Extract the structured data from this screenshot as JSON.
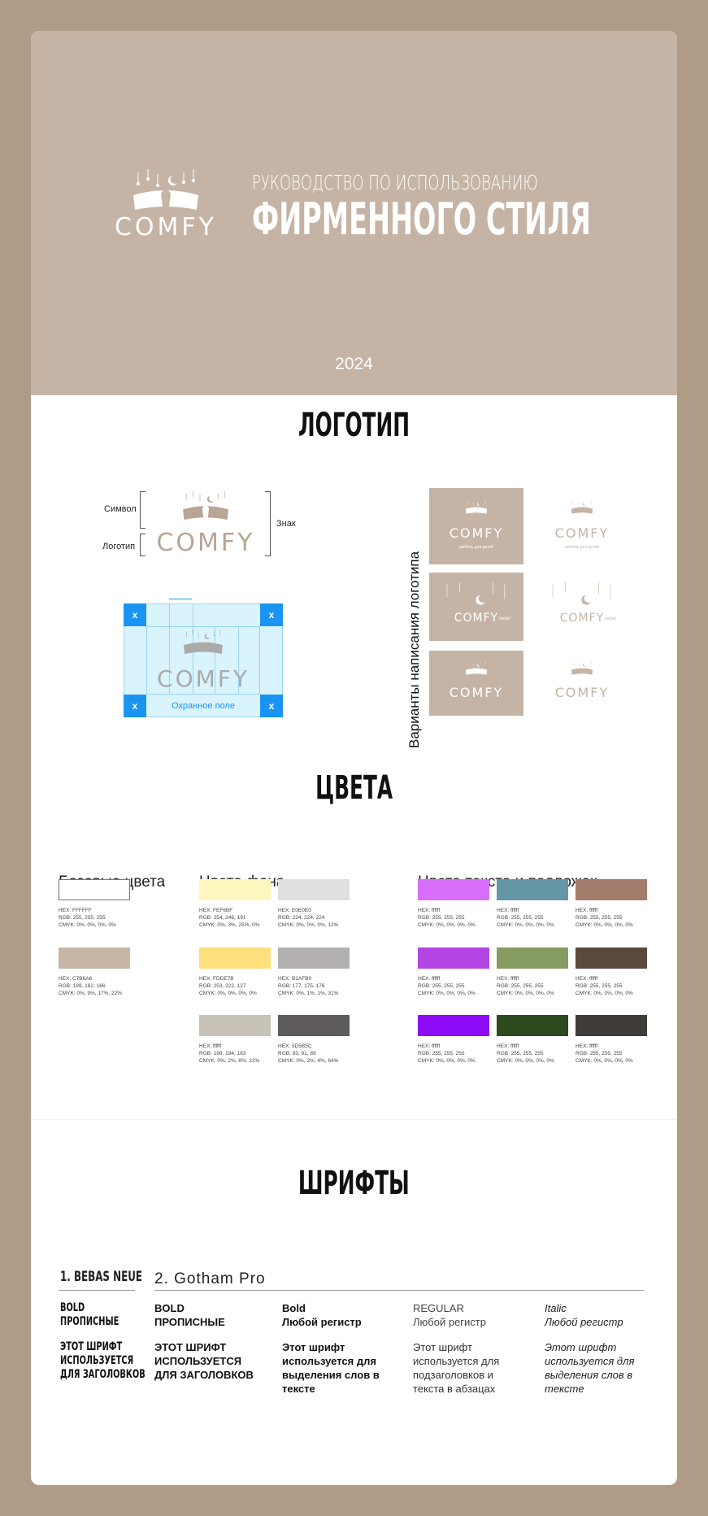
{
  "hero": {
    "brand": "COMFY",
    "subtitle": "РУКОВОДСТВО ПО ИСПОЛЬЗОВАНИЮ",
    "title": "ФИРМЕННОГО СТИЛЯ",
    "year": "2024"
  },
  "logo_section": {
    "title": "ЛОГОТИП",
    "label_symbol": "Символ",
    "label_logotype": "Логотип",
    "label_sign": "Знак",
    "protect_label": "Охранное поле",
    "x_marker": "x",
    "variants_label": "Варианты написания логотипа",
    "variants": [
      {
        "word": "COMFY",
        "tagline": "мебель для детей"
      },
      {
        "word": "COMFY",
        "tagline": "мебель для детей"
      },
      {
        "word": "COMFY",
        "tagline": "mebel"
      },
      {
        "word": "COMFY",
        "tagline": "mebel"
      },
      {
        "word": "COMFY",
        "tagline": ""
      },
      {
        "word": "COMFY",
        "tagline": ""
      }
    ]
  },
  "colors_section": {
    "title": "ЦВЕТА",
    "base_title": "Базовые цвета",
    "bg_title": "Цвета фона",
    "text_title": "Цвета текста и подложек",
    "base": [
      {
        "color": "#ffffff",
        "info": "HEX: FFFFFF\nRGB: 255, 255, 255\nCMYK: 0%, 0%, 0%, 0%"
      },
      {
        "color": "#c7b6a6",
        "info": "HEX: C7B6A6\nRGB: 199, 182, 166\nCMYK: 0%, 9%, 17%, 22%"
      }
    ],
    "background": [
      {
        "color": "#fef6bf",
        "info": "HEX: FEF6BF\nRGB: 254, 246, 191\nCMYK: 0%, 3%, 25%, 0%"
      },
      {
        "color": "#e0e0e0",
        "info": "HEX: E0E0E0\nRGB: 224, 224, 224\nCMYK: 0%, 0%, 0%, 12%"
      },
      {
        "color": "#fde07b",
        "info": "HEX: FDDE7B\nRGB: 253, 222, 127\nCMYK: 0%, 0%, 0%, 0%"
      },
      {
        "color": "#b1afb0",
        "info": "HEX: B1AFB0\nRGB: 177, 175, 176\nCMYK: 0%, 1%, 1%, 31%"
      },
      {
        "color": "#c6c2b7",
        "info": "HEX: ffffff\nRGB: 198, 194, 183\nCMYK: 0%, 2%, 8%, 22%"
      },
      {
        "color": "#5d5b5c",
        "info": "HEX: 5D5B5C\nRGB: 93, 91, 89\nCMYK: 0%, 2%, 4%, 64%"
      }
    ],
    "text": [
      {
        "color": "#d86ffb",
        "info": "HEX: ffffff\nRGB: 255, 255, 255\nCMYK: 0%, 0%, 0%, 0%"
      },
      {
        "color": "#6596a6",
        "info": "HEX: ffffff\nRGB: 255, 255, 255\nCMYK: 0%, 0%, 0%, 0%"
      },
      {
        "color": "#a57d6c",
        "info": "HEX: ffffff\nRGB: 255, 255, 255\nCMYK: 0%, 0%, 0%, 0%"
      },
      {
        "color": "#b345e3",
        "info": "HEX: ffffff\nRGB: 255, 255, 255\nCMYK: 0%, 0%, 0%, 0%"
      },
      {
        "color": "#859b61",
        "info": "HEX: ffffff\nRGB: 255, 255, 255\nCMYK: 0%, 0%, 0%, 0%"
      },
      {
        "color": "#5a4a3b",
        "info": "HEX: ffffff\nRGB: 255, 255, 255\nCMYK: 0%, 0%, 0%, 0%"
      },
      {
        "color": "#8e0cf8",
        "info": "HEX: ffffff\nRGB: 255, 255, 255\nCMYK: 0%, 0%, 0%, 0%"
      },
      {
        "color": "#2d4a1f",
        "info": "HEX: ffffff\nRGB: 255, 255, 255\nCMYK: 0%, 0%, 0%, 0%"
      },
      {
        "color": "#3f3d39",
        "info": "HEX: ffffff\nRGB: 255, 255, 255\nCMYK: 0%, 0%, 0%, 0%"
      }
    ]
  },
  "fonts_section": {
    "title": "ШРИФТЫ",
    "font1": "1. BEBAS NEUE",
    "font1_style": "BOLD\nПРОПИСНЫЕ",
    "font1_use": "ЭТОТ ШРИФТ\nИСПОЛЬЗУЕТСЯ\nДЛЯ ЗАГОЛОВКОВ",
    "font2": "2. Gotham Pro",
    "cols": [
      {
        "style": "BOLD\nПРОПИСНЫЕ",
        "use": "ЭТОТ ШРИФТ\nИСПОЛЬЗУЕТСЯ\nДЛЯ ЗАГОЛОВКОВ"
      },
      {
        "style": "Bold\nЛюбой регистр",
        "use": "Этот шрифт\nиспользуется для\nвыделения слов в\nтексте"
      },
      {
        "style": "REGULAR\nЛюбой регистр",
        "use": "Этот шрифт\nиспользуется для\nподзаголовков и\nтекста в абзацах"
      },
      {
        "style": "Italic\nЛюбой регистр",
        "use": "Этот шрифт\nиспользуется для\nвыделения слов в\nтексте"
      }
    ]
  },
  "palette": {
    "hero_bg": "#c5b4a5",
    "frame": "#b09c86",
    "protect_blue": "#1a94f2",
    "protect_bg": "#d9f4fd"
  }
}
